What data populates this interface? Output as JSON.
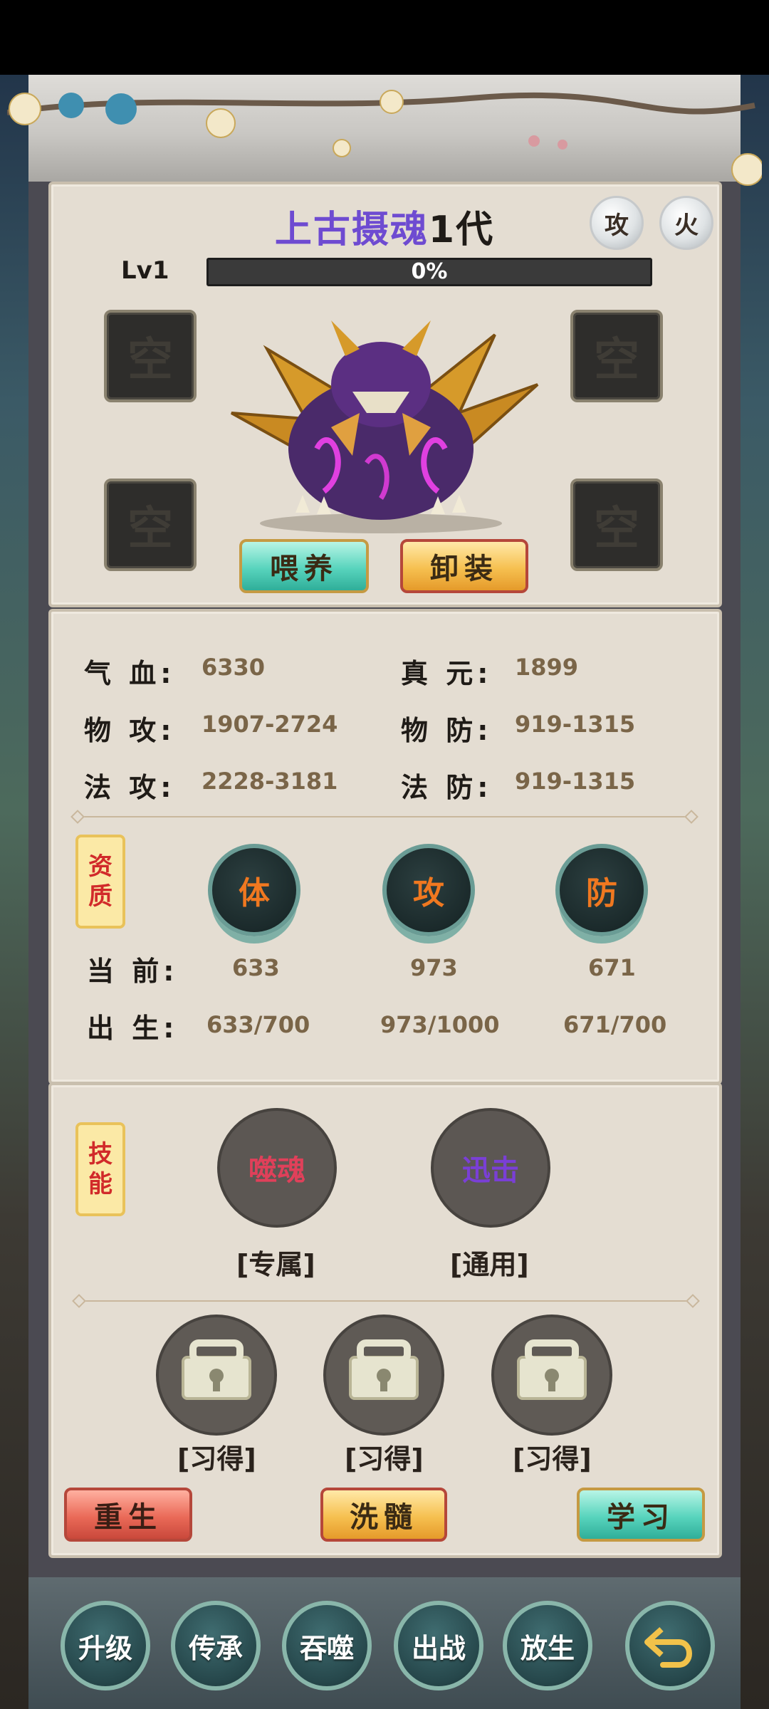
{
  "pet": {
    "name": "上古摄魂",
    "generation": "1代",
    "badges": [
      "攻",
      "火"
    ],
    "level": "Lv1",
    "exp_text": "0%",
    "empty_slot": "空",
    "feed_button": "喂养",
    "unequip_button": "卸装"
  },
  "stats": {
    "hp_label": "气 血:",
    "hp": "6330",
    "zhenyuan_label": "真 元:",
    "zhenyuan": "1899",
    "patk_label": "物 攻:",
    "patk": "1907-2724",
    "pdef_label": "物 防:",
    "pdef": "919-1315",
    "matk_label": "法 攻:",
    "matk": "2228-3181",
    "mdef_label": "法 防:",
    "mdef": "919-1315"
  },
  "aptitude": {
    "tag": "资\n质",
    "orbs": [
      "体",
      "攻",
      "防"
    ],
    "current_label": "当 前:",
    "current": [
      "633",
      "973",
      "671"
    ],
    "birth_label": "出 生:",
    "birth": [
      "633/700",
      "973/1000",
      "671/700"
    ]
  },
  "skills": {
    "tag": "技\n能",
    "items": [
      {
        "name": "噬魂",
        "caption": "[专属]",
        "color": "#e0405a"
      },
      {
        "name": "迅击",
        "caption": "[通用]",
        "color": "#7a3fd6"
      }
    ],
    "learned_caption": "[习得]"
  },
  "actions": {
    "rebirth": "重生",
    "wash": "洗髓",
    "learn": "学习"
  },
  "nav": [
    "升级",
    "传承",
    "吞噬",
    "出战",
    "放生"
  ],
  "colors": {
    "title": "#6e4bd1",
    "stat_value": "#7a6548",
    "aptitude_orb_text": "#f07820",
    "tag_text": "#d12a2a"
  }
}
